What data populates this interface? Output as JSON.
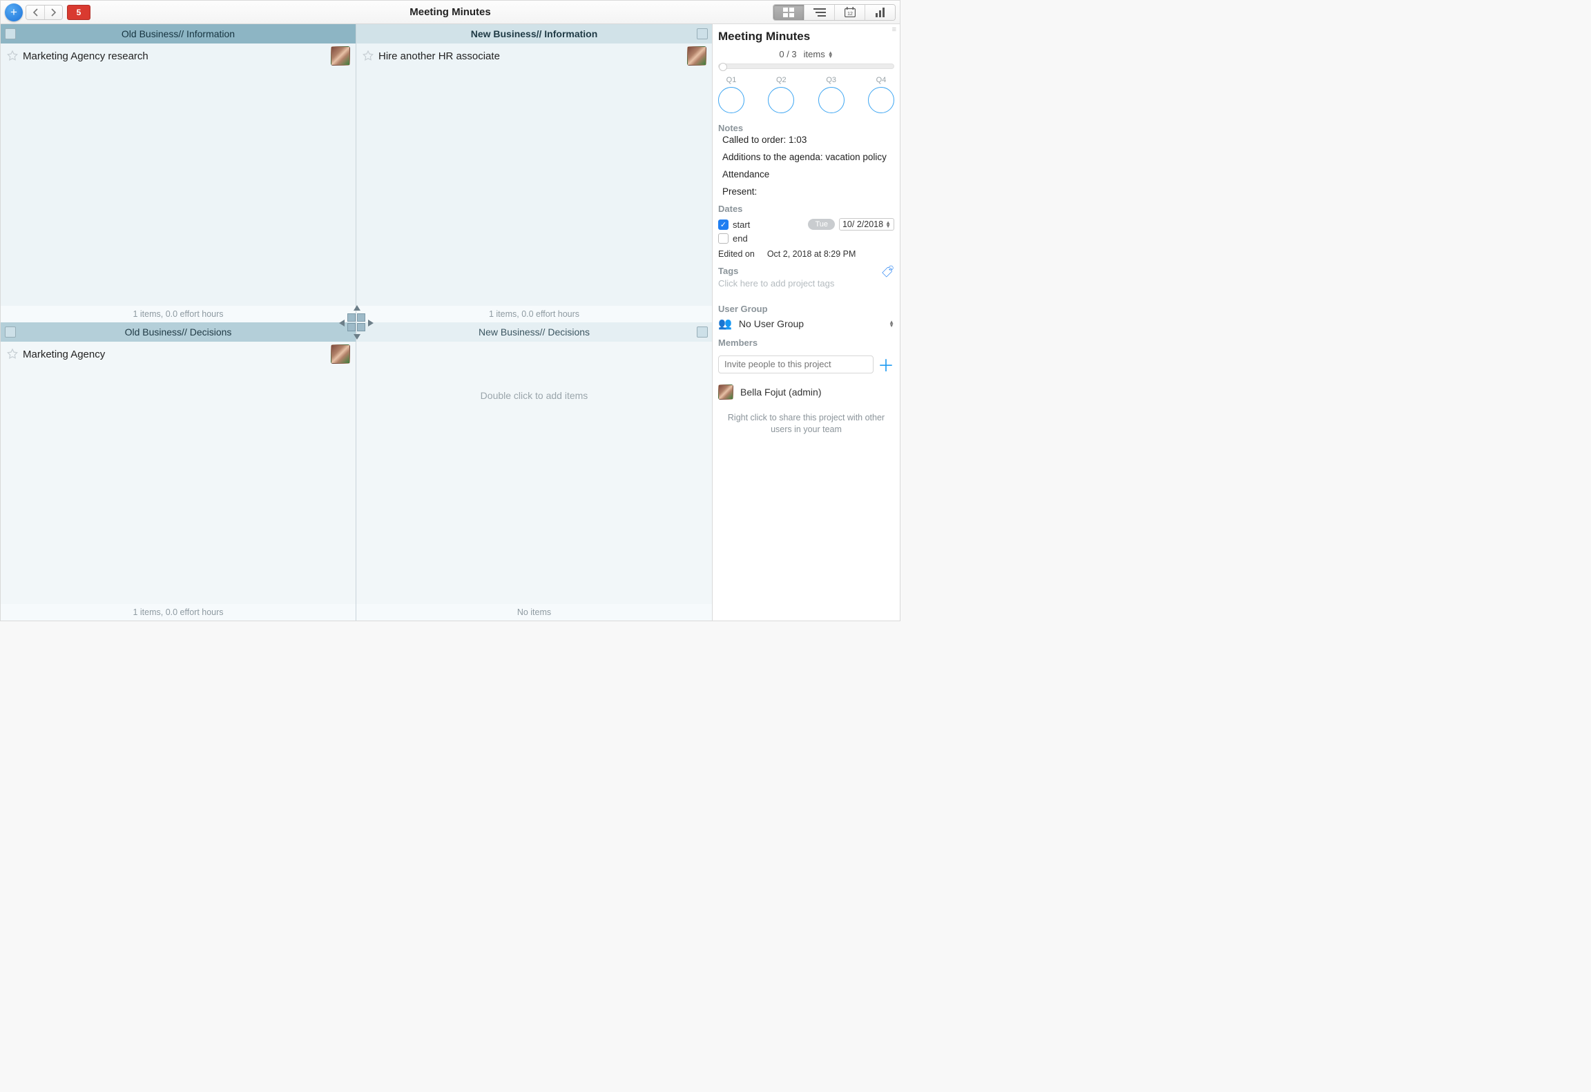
{
  "toolbar": {
    "title": "Meeting Minutes",
    "notification_count": "5"
  },
  "quadrants": [
    {
      "header": "Old Business// Information",
      "items": [
        {
          "title": "Marketing Agency research",
          "has_avatar": true
        }
      ],
      "footer": "1 items, 0.0 effort hours"
    },
    {
      "header": "New Business// Information",
      "items": [
        {
          "title": "Hire another HR associate",
          "has_avatar": true
        }
      ],
      "footer": "1 items, 0.0 effort hours"
    },
    {
      "header": "Old Business// Decisions",
      "items": [
        {
          "title": "Marketing Agency",
          "has_avatar": true
        }
      ],
      "footer": "1 items, 0.0 effort hours"
    },
    {
      "header": "New Business// Decisions",
      "items": [],
      "empty_hint": "Double click to add items",
      "footer": "No items"
    }
  ],
  "inspector": {
    "title": "Meeting Minutes",
    "progress": {
      "count": "0 / 3",
      "unit": "items"
    },
    "quarters": [
      "Q1",
      "Q2",
      "Q3",
      "Q4"
    ],
    "notes_label": "Notes",
    "notes": [
      "Called to order: 1:03",
      "Additions to the agenda: vacation policy",
      "Attendance",
      "Present:"
    ],
    "dates_label": "Dates",
    "start_label": "start",
    "start_day": "Tue",
    "start_date": "10/  2/2018",
    "end_label": "end",
    "edited_label": "Edited on",
    "edited_value": "Oct 2, 2018 at 8:29 PM",
    "tags_label": "Tags",
    "tags_placeholder": "Click here to add project tags",
    "user_group_label": "User Group",
    "user_group_value": "No User Group",
    "members_label": "Members",
    "invite_placeholder": "Invite people to this project",
    "member_name": "Bella Fojut (admin)",
    "share_hint": "Right click to share this project with other users in your team"
  }
}
